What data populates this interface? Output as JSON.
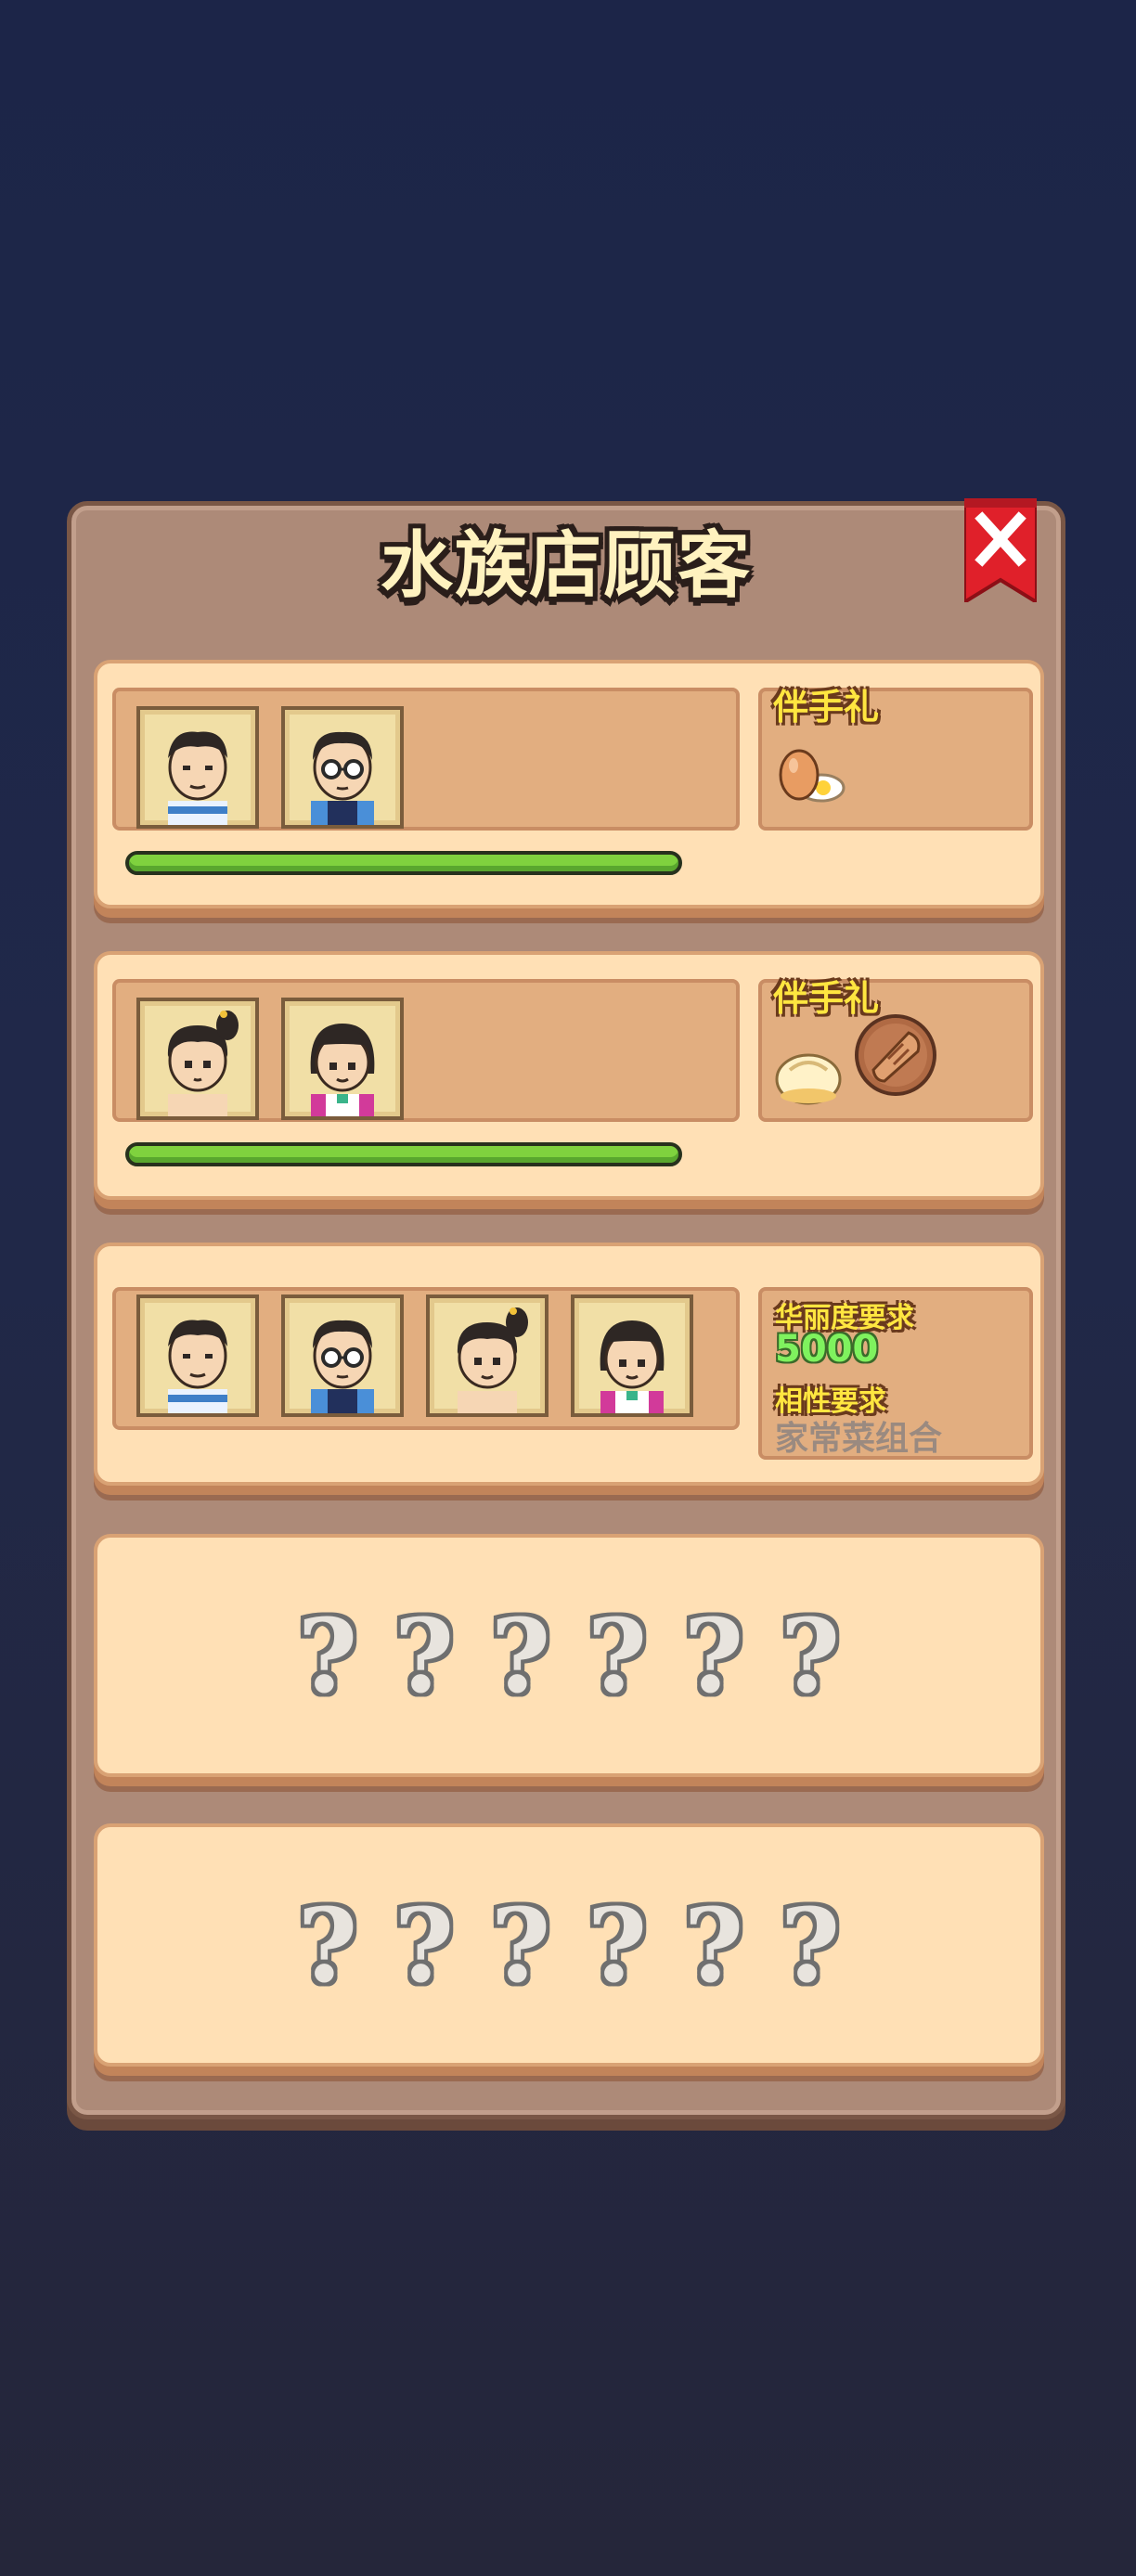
{
  "window": {
    "title": "水族店顾客"
  },
  "groups": [
    {
      "gift_label": "伴手礼",
      "avatars": [
        "man-customer",
        "glasses-man-customer"
      ],
      "progress": 1.0,
      "gifts": [
        "egg-icon"
      ]
    },
    {
      "gift_label": "伴手礼",
      "avatars": [
        "ponytail-girl-customer",
        "bob-girl-customer"
      ],
      "progress": 1.0,
      "gifts": [
        "steamed-bun-icon",
        "grilled-fish-icon"
      ]
    },
    {
      "avatars": [
        "man-customer",
        "glasses-man-customer",
        "ponytail-girl-customer",
        "bob-girl-customer"
      ],
      "requirements": {
        "luxury_label": "华丽度要求",
        "luxury_value": "5000",
        "affinity_label": "相性要求",
        "affinity_value": "家常菜组合"
      }
    },
    {
      "locked": true,
      "mystery": [
        "?",
        "?",
        "?",
        "?",
        "?",
        "?"
      ]
    },
    {
      "locked": true,
      "mystery": [
        "?",
        "?",
        "?",
        "?",
        "?",
        "?"
      ]
    }
  ],
  "colors": {
    "progress": "#7fd23e",
    "title": "#fff2bf",
    "close": "#e0202a"
  }
}
